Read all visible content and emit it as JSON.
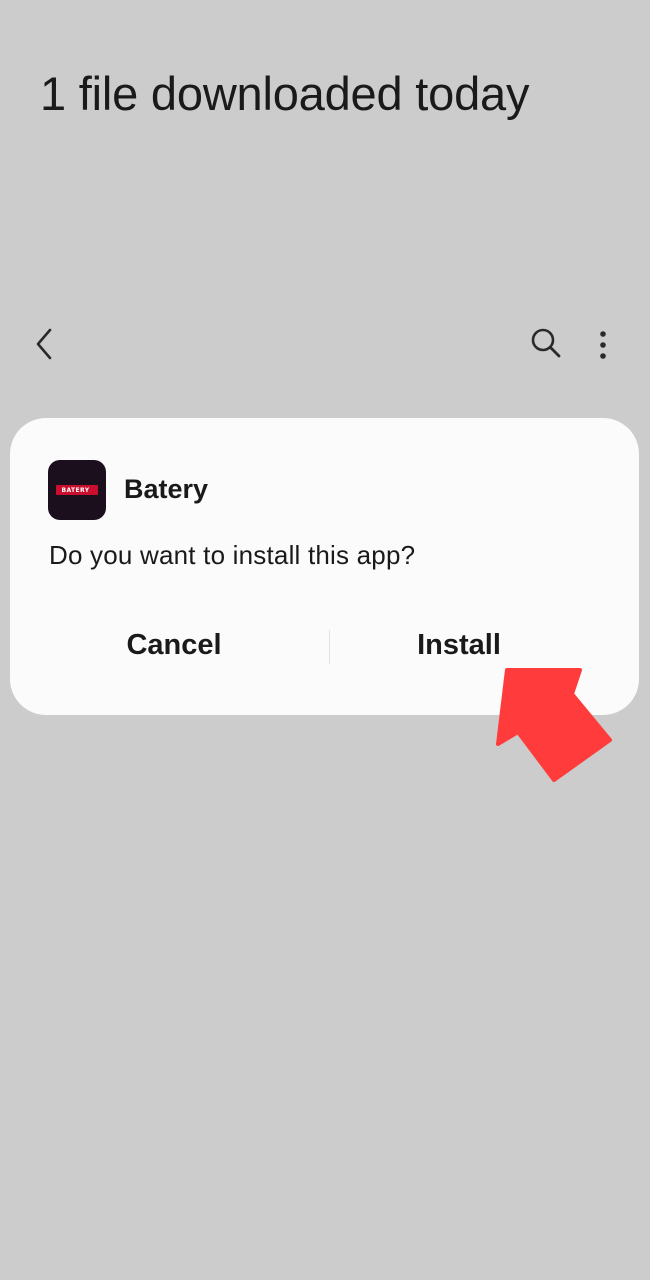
{
  "page": {
    "title": "1 file downloaded today"
  },
  "toolbar": {
    "back_icon": "back-chevron-icon",
    "search_icon": "search-icon",
    "more_icon": "more-vertical-icon"
  },
  "dialog": {
    "app_icon_text": "BATERY",
    "app_name": "Batery",
    "question": "Do you want to install this app?",
    "cancel_label": "Cancel",
    "install_label": "Install"
  },
  "annotation": {
    "arrow_icon": "pointer-arrow-icon",
    "arrow_color": "#ff3b3b"
  },
  "colors": {
    "background": "#cccccc",
    "dialog": "#fbfbfb",
    "app_icon_bg": "#1b0f1e",
    "app_logo_red": "#c8102e",
    "text": "#1a1a1a"
  }
}
